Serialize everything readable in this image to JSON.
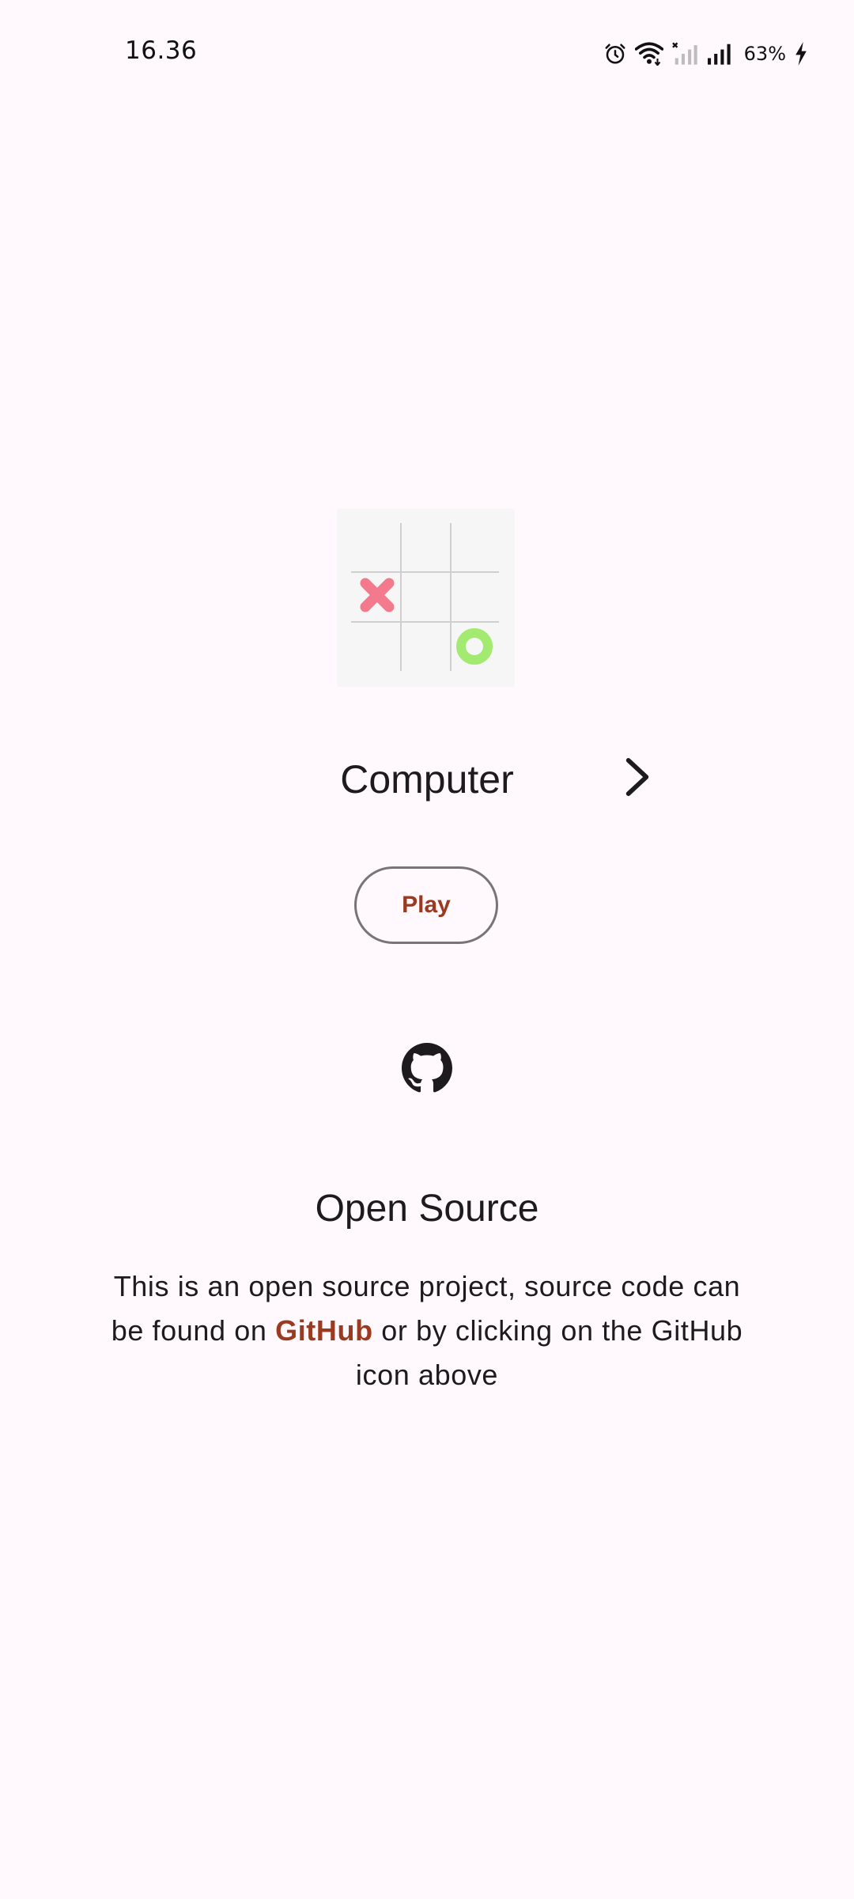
{
  "status_bar": {
    "time": "16.36",
    "battery_percent": "63%",
    "icons": [
      "alarm-icon",
      "wifi-icon",
      "no-signal-sim-icon",
      "signal-icon",
      "charging-icon"
    ]
  },
  "game": {
    "board_icon": "tic-tac-toe-board-icon",
    "x_color": "#F27A8C",
    "o_color": "#A3EB70",
    "mode_label": "Computer",
    "next_mode_icon": "chevron-right-icon",
    "play_label": "Play"
  },
  "open_source": {
    "github_icon": "github-icon",
    "title": "Open Source",
    "desc_before": "This is an open source project, source code can be found on ",
    "link_text": "GitHub",
    "desc_after": " or by clicking on the GitHub icon above"
  },
  "colors": {
    "background": "#FFF8FC",
    "accent": "#9A3A20",
    "outline": "#7A7477"
  }
}
